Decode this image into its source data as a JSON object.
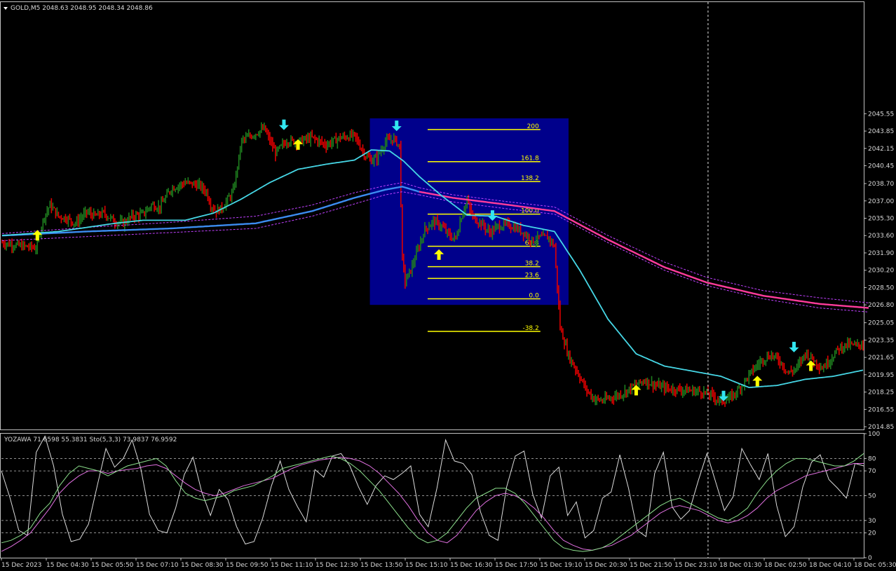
{
  "header": {
    "main_title": "GOLD,M5  2048.63 2048.95 2048.34 2048.86",
    "sub_title": "YOZAWA 71.6598 55.3831  Sto(5,3,3) 73.9837 76.9592"
  },
  "colors": {
    "background": "#000000",
    "grid": "#c0c0c0",
    "bull": "#1e7d1e",
    "bear": "#e00000",
    "ma_fast": "#46d7e6",
    "ma_slow": "#3c8cf0",
    "ma_pink": "#ff3c9c",
    "band": "#c040ff",
    "fib": "#ffff00",
    "fib_box": "#00008b",
    "arrow_up": "#ffff00",
    "arrow_down": "#32e6f0",
    "osc_white": "#dcdcdc",
    "osc_pink": "#e070e0",
    "osc_green": "#8ce08c"
  },
  "chart_data": [
    {
      "type": "bar",
      "name": "GOLD,M5",
      "ylim": [
        2014.58,
        2056.5
      ],
      "y_ticks": [
        "2045.55",
        "2043.85",
        "2042.15",
        "2040.45",
        "2038.70",
        "2037.00",
        "2035.30",
        "2033.60",
        "2031.90",
        "2030.20",
        "2028.50",
        "2026.80",
        "2025.05",
        "2023.35",
        "2021.65",
        "2019.95",
        "2018.25",
        "2016.55",
        "2014.85"
      ],
      "x_ticks": [
        "15 Dec 2023",
        "15 Dec 04:30",
        "15 Dec 05:50",
        "15 Dec 07:10",
        "15 Dec 08:30",
        "15 Dec 09:50",
        "15 Dec 11:10",
        "15 Dec 12:30",
        "15 Dec 13:50",
        "15 Dec 15:10",
        "15 Dec 16:30",
        "15 Dec 17:50",
        "15 Dec 19:10",
        "15 Dec 20:30",
        "15 Dec 21:50",
        "15 Dec 23:10",
        "18 Dec 01:30",
        "18 Dec 02:50",
        "18 Dec 04:10",
        "18 Dec 05:30"
      ],
      "price_path": [
        [
          0,
          2032.9
        ],
        [
          12,
          2032.6
        ],
        [
          18,
          2032.5
        ],
        [
          24,
          2032.4
        ],
        [
          30,
          2035.5
        ],
        [
          34,
          2036.6
        ],
        [
          40,
          2035.5
        ],
        [
          46,
          2035.3
        ],
        [
          52,
          2034.8
        ],
        [
          60,
          2035.9
        ],
        [
          66,
          2035.5
        ],
        [
          72,
          2035.8
        ],
        [
          80,
          2035.0
        ],
        [
          86,
          2034.8
        ],
        [
          92,
          2035.5
        ],
        [
          100,
          2035.7
        ],
        [
          106,
          2036.6
        ],
        [
          112,
          2036.4
        ],
        [
          120,
          2038.2
        ],
        [
          130,
          2038.8
        ],
        [
          140,
          2038.5
        ],
        [
          145,
          2037.9
        ],
        [
          148,
          2036.6
        ],
        [
          152,
          2036.0
        ],
        [
          156,
          2036.3
        ],
        [
          164,
          2037.9
        ],
        [
          170,
          2042.9
        ],
        [
          178,
          2043.5
        ],
        [
          186,
          2044.1
        ],
        [
          194,
          2041.7
        ],
        [
          202,
          2042.9
        ],
        [
          210,
          2042.8
        ],
        [
          220,
          2043.2
        ],
        [
          230,
          2042.5
        ],
        [
          240,
          2043.2
        ],
        [
          250,
          2043.4
        ],
        [
          258,
          2041.4
        ],
        [
          262,
          2041.0
        ],
        [
          266,
          2041.2
        ],
        [
          272,
          2042.8
        ],
        [
          278,
          2043.1
        ],
        [
          282,
          2042.4
        ],
        [
          284,
          2031.2
        ],
        [
          286,
          2029.1
        ],
        [
          290,
          2030.2
        ],
        [
          294,
          2031.8
        ],
        [
          300,
          2034.2
        ],
        [
          306,
          2035.0
        ],
        [
          312,
          2034.5
        ],
        [
          318,
          2033.5
        ],
        [
          322,
          2033.3
        ],
        [
          326,
          2035.5
        ],
        [
          330,
          2037.0
        ],
        [
          334,
          2035.4
        ],
        [
          340,
          2034.8
        ],
        [
          346,
          2033.9
        ],
        [
          352,
          2034.5
        ],
        [
          358,
          2034.7
        ],
        [
          364,
          2034.4
        ],
        [
          370,
          2033.9
        ],
        [
          376,
          2033.1
        ],
        [
          382,
          2033.4
        ],
        [
          388,
          2033.4
        ],
        [
          392,
          2032.5
        ],
        [
          396,
          2024.6
        ],
        [
          402,
          2021.8
        ],
        [
          408,
          2020.3
        ],
        [
          414,
          2018.6
        ],
        [
          420,
          2017.6
        ],
        [
          426,
          2017.4
        ],
        [
          432,
          2017.7
        ],
        [
          440,
          2018.1
        ],
        [
          448,
          2018.8
        ],
        [
          456,
          2019.4
        ],
        [
          464,
          2018.9
        ],
        [
          472,
          2018.6
        ],
        [
          480,
          2018.5
        ],
        [
          488,
          2018.4
        ],
        [
          496,
          2018.3
        ],
        [
          504,
          2017.9
        ],
        [
          510,
          2017.3
        ],
        [
          516,
          2017.6
        ],
        [
          522,
          2018.4
        ],
        [
          528,
          2019.5
        ],
        [
          534,
          2020.6
        ],
        [
          540,
          2021.5
        ],
        [
          546,
          2021.9
        ],
        [
          552,
          2021.3
        ],
        [
          558,
          2020.1
        ],
        [
          564,
          2020.6
        ],
        [
          570,
          2022.1
        ],
        [
          576,
          2021.4
        ],
        [
          582,
          2020.6
        ],
        [
          588,
          2021.5
        ],
        [
          594,
          2022.6
        ],
        [
          600,
          2022.9
        ],
        [
          606,
          2022.8
        ],
        [
          611,
          2023.0
        ]
      ],
      "ma_fast": [
        [
          0,
          2033.6
        ],
        [
          40,
          2034.0
        ],
        [
          80,
          2034.8
        ],
        [
          100,
          2035.1
        ],
        [
          130,
          2035.1
        ],
        [
          150,
          2035.8
        ],
        [
          170,
          2037.2
        ],
        [
          190,
          2038.8
        ],
        [
          210,
          2040.1
        ],
        [
          230,
          2040.6
        ],
        [
          250,
          2041.0
        ],
        [
          262,
          2042.0
        ],
        [
          275,
          2041.9
        ],
        [
          285,
          2040.9
        ],
        [
          296,
          2039.4
        ],
        [
          312,
          2037.5
        ],
        [
          330,
          2035.6
        ],
        [
          350,
          2035.5
        ],
        [
          370,
          2034.6
        ],
        [
          392,
          2034.0
        ],
        [
          410,
          2030.2
        ],
        [
          430,
          2025.4
        ],
        [
          450,
          2022.0
        ],
        [
          470,
          2020.8
        ],
        [
          490,
          2020.3
        ],
        [
          510,
          2019.8
        ],
        [
          530,
          2018.7
        ],
        [
          550,
          2018.9
        ],
        [
          570,
          2019.5
        ],
        [
          590,
          2019.8
        ],
        [
          611,
          2020.4
        ]
      ],
      "ma_slow": [
        [
          0,
          2033.6
        ],
        [
          60,
          2034.0
        ],
        [
          120,
          2034.3
        ],
        [
          180,
          2034.8
        ],
        [
          220,
          2036.0
        ],
        [
          250,
          2037.3
        ],
        [
          272,
          2038.1
        ],
        [
          284,
          2038.4
        ],
        [
          296,
          2037.9
        ]
      ],
      "ma_pink": [
        [
          296,
          2037.9
        ],
        [
          320,
          2037.3
        ],
        [
          360,
          2036.6
        ],
        [
          392,
          2036.0
        ],
        [
          430,
          2033.2
        ],
        [
          470,
          2030.5
        ],
        [
          500,
          2029.0
        ],
        [
          540,
          2027.7
        ],
        [
          580,
          2026.9
        ],
        [
          615,
          2026.5
        ]
      ],
      "ma_pink_upper": [
        [
          296,
          2038.3
        ],
        [
          320,
          2037.6
        ],
        [
          360,
          2036.9
        ],
        [
          392,
          2036.4
        ],
        [
          430,
          2033.6
        ],
        [
          470,
          2031.0
        ],
        [
          500,
          2029.5
        ],
        [
          540,
          2028.2
        ],
        [
          580,
          2027.5
        ],
        [
          615,
          2027.0
        ]
      ],
      "ma_pink_lower": [
        [
          296,
          2037.6
        ],
        [
          320,
          2036.9
        ],
        [
          360,
          2036.2
        ],
        [
          392,
          2035.7
        ],
        [
          430,
          2032.9
        ],
        [
          470,
          2030.2
        ],
        [
          500,
          2028.7
        ],
        [
          540,
          2027.4
        ],
        [
          580,
          2026.5
        ],
        [
          615,
          2026.1
        ]
      ],
      "band_upper": [
        [
          0,
          2033.8
        ],
        [
          60,
          2034.4
        ],
        [
          120,
          2034.9
        ],
        [
          180,
          2035.5
        ],
        [
          220,
          2036.6
        ],
        [
          250,
          2037.8
        ],
        [
          272,
          2038.5
        ],
        [
          284,
          2038.8
        ],
        [
          296,
          2038.3
        ]
      ],
      "band_lower": [
        [
          0,
          2033.1
        ],
        [
          60,
          2033.5
        ],
        [
          120,
          2033.9
        ],
        [
          180,
          2034.3
        ],
        [
          220,
          2035.5
        ],
        [
          250,
          2036.7
        ],
        [
          272,
          2037.6
        ],
        [
          284,
          2037.9
        ],
        [
          296,
          2037.6
        ]
      ],
      "arrows_up": [
        [
          25,
          2033.6
        ],
        [
          210,
          2042.5
        ],
        [
          310,
          2031.7
        ],
        [
          450,
          2018.4
        ],
        [
          536,
          2019.3
        ],
        [
          574,
          2020.8
        ]
      ],
      "arrows_down": [
        [
          200,
          2044.5
        ],
        [
          280,
          2044.4
        ],
        [
          348,
          2035.6
        ],
        [
          512,
          2017.9
        ],
        [
          562,
          2022.7
        ]
      ],
      "fibonacci": {
        "anchor_x_start": 302,
        "anchor_x_end": 382,
        "levels": [
          {
            "label": "200",
            "price": 2044.0
          },
          {
            "label": "161.8",
            "price": 2040.85
          },
          {
            "label": "138.2",
            "price": 2038.9
          },
          {
            "label": "100.0",
            "price": 2035.7
          },
          {
            "label": "61.8",
            "price": 2032.55
          },
          {
            "label": "38.2",
            "price": 2030.55
          },
          {
            "label": "23.6",
            "price": 2029.4
          },
          {
            "label": "0.0",
            "price": 2027.4
          },
          {
            "label": "-38.2",
            "price": 2024.2
          }
        ],
        "box": {
          "x_start": 261,
          "x_end": 402,
          "price_top": 2045.1,
          "price_bottom": 2026.8
        }
      },
      "separator_bar": 501
    },
    {
      "type": "line",
      "name": "YOZAWA / Sto(5,3,3)",
      "ylim": [
        0,
        100
      ],
      "y_ticks": [
        "100",
        "80",
        "70",
        "50",
        "30",
        "20",
        "0"
      ],
      "levels": [
        80,
        70,
        50,
        30,
        20
      ],
      "series": [
        {
          "role": "white",
          "values": [
            70,
            48,
            22,
            18,
            85,
            98,
            74,
            35,
            13,
            15,
            27,
            58,
            88,
            73,
            80,
            95,
            72,
            35,
            22,
            20,
            40,
            67,
            81,
            53,
            34,
            55,
            47,
            25,
            11,
            13,
            32,
            58,
            78,
            55,
            41,
            29,
            71,
            65,
            82,
            84,
            74,
            57,
            43,
            58,
            66,
            63,
            68,
            74,
            35,
            25,
            56,
            95,
            78,
            76,
            67,
            37,
            18,
            14,
            57,
            82,
            86,
            51,
            32,
            66,
            73,
            34,
            45,
            16,
            22,
            48,
            53,
            83,
            56,
            22,
            17,
            68,
            85,
            41,
            31,
            38,
            62,
            84,
            61,
            38,
            49,
            88,
            75,
            63,
            84,
            42,
            17,
            25,
            57,
            77,
            83,
            63,
            56,
            48,
            76,
            74
          ]
        },
        {
          "role": "pink",
          "values": [
            5,
            9,
            14,
            20,
            30,
            40,
            52,
            60,
            66,
            70,
            70,
            68,
            70,
            71,
            72,
            74,
            75,
            72,
            66,
            60,
            55,
            52,
            50,
            52,
            55,
            58,
            60,
            62,
            64,
            68,
            72,
            75,
            77,
            79,
            80,
            81,
            80,
            78,
            74,
            68,
            60,
            52,
            42,
            30,
            20,
            14,
            12,
            18,
            28,
            38,
            45,
            50,
            52,
            50,
            46,
            40,
            32,
            22,
            14,
            10,
            7,
            6,
            8,
            10,
            14,
            18,
            24,
            30,
            36,
            40,
            42,
            40,
            38,
            34,
            30,
            28,
            30,
            34,
            40,
            48,
            54,
            58,
            62,
            66,
            68,
            70,
            72,
            74,
            76,
            76
          ]
        },
        {
          "role": "green",
          "values": [
            12,
            14,
            18,
            24,
            36,
            44,
            58,
            68,
            74,
            72,
            70,
            66,
            70,
            74,
            76,
            78,
            80,
            74,
            62,
            52,
            48,
            46,
            48,
            50,
            54,
            56,
            58,
            62,
            66,
            72,
            74,
            76,
            78,
            80,
            82,
            80,
            76,
            70,
            62,
            54,
            44,
            34,
            24,
            16,
            12,
            14,
            20,
            30,
            40,
            48,
            52,
            56,
            56,
            52,
            44,
            34,
            24,
            14,
            8,
            6,
            5,
            6,
            8,
            12,
            18,
            24,
            30,
            36,
            42,
            46,
            48,
            44,
            40,
            36,
            32,
            30,
            34,
            40,
            52,
            62,
            70,
            76,
            80,
            80,
            78,
            76,
            74,
            74,
            78,
            84
          ]
        }
      ]
    }
  ]
}
